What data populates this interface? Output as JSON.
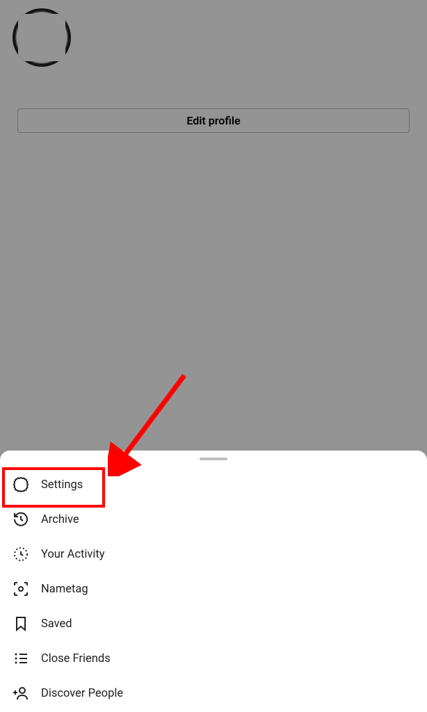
{
  "profile": {
    "edit_button_label": "Edit profile"
  },
  "menu": {
    "items": [
      {
        "label": "Settings"
      },
      {
        "label": "Archive"
      },
      {
        "label": "Your Activity"
      },
      {
        "label": "Nametag"
      },
      {
        "label": "Saved"
      },
      {
        "label": "Close Friends"
      },
      {
        "label": "Discover People"
      }
    ]
  },
  "annotation": {
    "highlighted_item": "Settings"
  }
}
